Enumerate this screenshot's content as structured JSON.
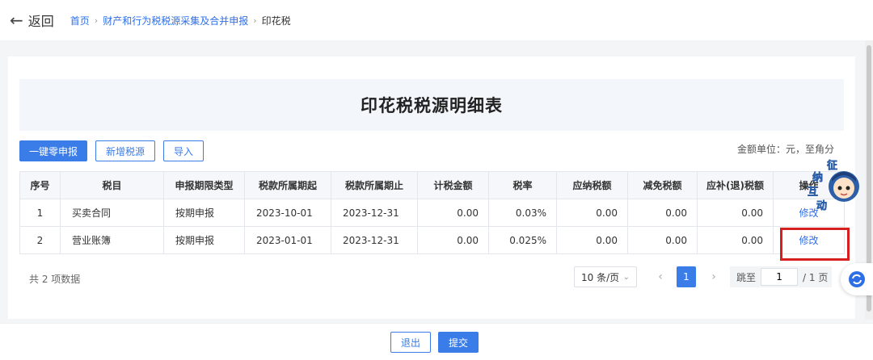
{
  "nav": {
    "back_label": "返回",
    "breadcrumb": [
      "首页",
      "财产和行为税税源采集及合并申报"
    ],
    "current": "印花税"
  },
  "page_title": "印花税税源明细表",
  "toolbar": {
    "zero_declare": "一键零申报",
    "add_source": "新增税源",
    "import": "导入"
  },
  "unit_note": "金额单位：元，至角分",
  "table": {
    "headers": [
      "序号",
      "税目",
      "申报期限类型",
      "税款所属期起",
      "税款所属期止",
      "计税金额",
      "税率",
      "应纳税额",
      "减免税额",
      "应补(退)税额",
      "操作"
    ],
    "rows": [
      [
        "1",
        "买卖合同",
        "按期申报",
        "2023-10-01",
        "2023-12-31",
        "0.00",
        "0.03%",
        "0.00",
        "0.00",
        "0.00",
        "修改"
      ],
      [
        "2",
        "营业账簿",
        "按期申报",
        "2023-01-01",
        "2023-12-31",
        "0.00",
        "0.025%",
        "0.00",
        "0.00",
        "0.00",
        "修改"
      ]
    ]
  },
  "pagination": {
    "total_text": "共 2 项数据",
    "page_size": "10 条/页",
    "current_page": "1",
    "jump_label": "跳至",
    "jump_value": "1",
    "page_total": "/ 1 页"
  },
  "footer": {
    "exit_label": "退出",
    "submit_label": "提交"
  },
  "mascot_text": [
    "征",
    "纳",
    "互",
    "动"
  ],
  "colors": {
    "primary": "#3a7ce8",
    "link": "#2e6fe6",
    "highlight": "#d62020"
  }
}
